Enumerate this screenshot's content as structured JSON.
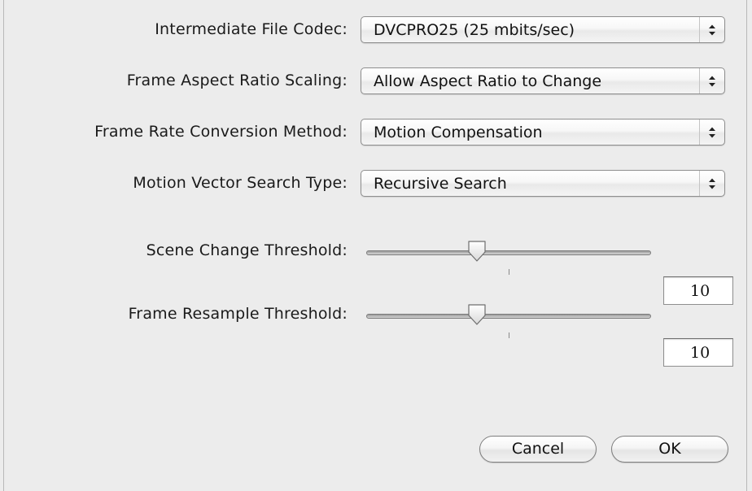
{
  "settings": {
    "codec": {
      "label": "Intermediate File Codec:",
      "value": "DVCPRO25 (25 mbits/sec)"
    },
    "aspect": {
      "label": "Frame Aspect Ratio Scaling:",
      "value": "Allow Aspect Ratio to Change"
    },
    "framerate": {
      "label": "Frame Rate Conversion Method:",
      "value": "Motion Compensation"
    },
    "motion": {
      "label": "Motion Vector Search Type:",
      "value": "Recursive Search"
    }
  },
  "sliders": {
    "scene_change": {
      "label": "Scene Change Threshold:",
      "value": "10",
      "fraction": 0.38
    },
    "frame_resample": {
      "label": "Frame Resample Threshold:",
      "value": "10",
      "fraction": 0.38
    }
  },
  "buttons": {
    "cancel": "Cancel",
    "ok": "OK"
  },
  "icons": {
    "popup_arrows": "up-down-chevrons-icon",
    "slider_knob": "slider-knob-icon"
  },
  "colors": {
    "background": "#ececec",
    "border": "#8e8e8e"
  }
}
